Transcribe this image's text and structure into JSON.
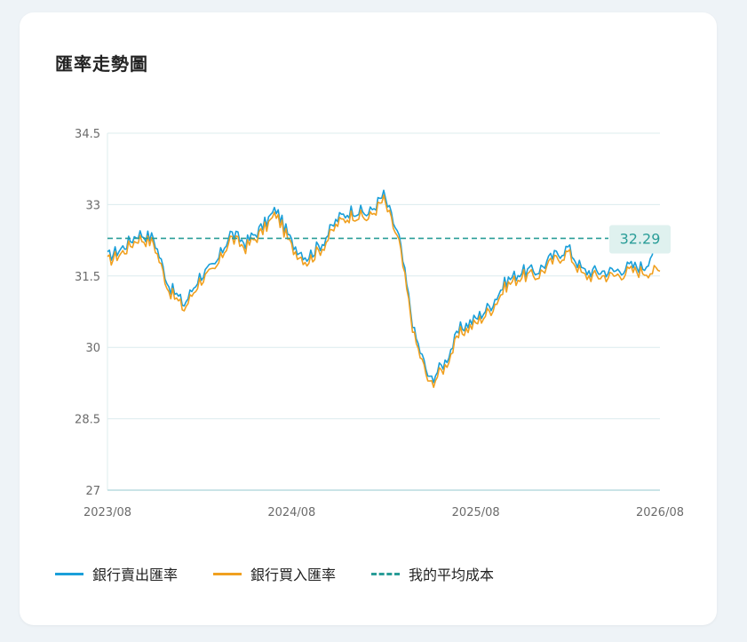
{
  "title": "匯率走勢圖",
  "legend": {
    "sell_label": "銀行賣出匯率",
    "buy_label": "銀行買入匯率",
    "cost_label": "我的平均成本"
  },
  "colors": {
    "sell": "#1a9fd9",
    "buy": "#f0a020",
    "cost": "#2a9d98",
    "grid": "#dcecee"
  },
  "chart_data": {
    "type": "line",
    "x_ticks": [
      "2023/08",
      "2024/08",
      "2025/08",
      "2026/08"
    ],
    "y_ticks": [
      "34.5",
      "33",
      "31.5",
      "30",
      "28.5",
      "27"
    ],
    "ylim": [
      27,
      34.5
    ],
    "xlim": [
      "2023/08",
      "2026/08"
    ],
    "grid": true,
    "legend_position": "bottom-left",
    "cost_label_value": "32.29",
    "reference_line": {
      "name": "我的平均成本",
      "value": 32.29
    },
    "x": [
      "2023/08",
      "2023/09",
      "2023/10",
      "2023/11",
      "2023/12",
      "2024/01",
      "2024/02",
      "2024/03",
      "2024/04",
      "2024/05",
      "2024/06",
      "2024/07",
      "2024/08",
      "2024/09",
      "2024/10",
      "2024/11",
      "2024/12",
      "2025/01",
      "2025/02",
      "2025/03",
      "2025/04",
      "2025/05",
      "2025/06",
      "2025/07",
      "2025/08",
      "2025/09",
      "2025/10",
      "2025/11",
      "2025/12",
      "2026/01",
      "2026/02",
      "2026/03",
      "2026/04",
      "2026/05",
      "2026/06",
      "2026/07",
      "2026/08"
    ],
    "series": [
      {
        "name": "銀行賣出匯率",
        "values": [
          31.9,
          32.1,
          32.4,
          32.3,
          31.3,
          30.9,
          31.5,
          31.7,
          32.4,
          32.2,
          32.5,
          32.9,
          32.2,
          31.9,
          32.2,
          32.7,
          32.9,
          32.8,
          33.2,
          32.3,
          30.3,
          29.3,
          29.7,
          30.4,
          30.6,
          30.9,
          31.4,
          31.6,
          31.6,
          31.9,
          32.1,
          31.6,
          31.6,
          31.6,
          31.7,
          31.7,
          32.3
        ]
      },
      {
        "name": "銀行買入匯率",
        "values": [
          31.8,
          32.0,
          32.3,
          32.2,
          31.2,
          30.8,
          31.4,
          31.6,
          32.3,
          32.1,
          32.4,
          32.8,
          32.1,
          31.8,
          32.1,
          32.6,
          32.8,
          32.7,
          33.1,
          32.2,
          30.2,
          29.2,
          29.6,
          30.3,
          30.5,
          30.8,
          31.3,
          31.5,
          31.5,
          31.8,
          32.0,
          31.5,
          31.5,
          31.5,
          31.6,
          31.6,
          31.6
        ]
      }
    ]
  }
}
